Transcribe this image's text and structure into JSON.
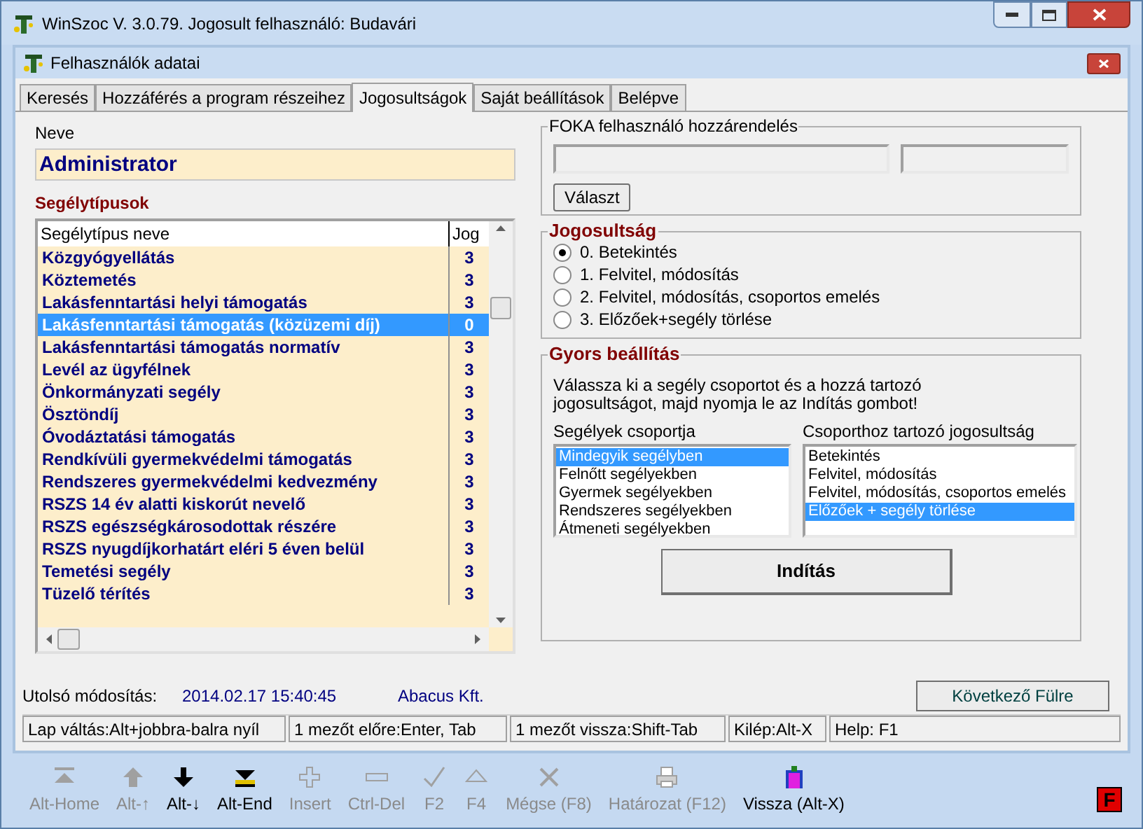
{
  "window": {
    "title": "WinSzoc V. 3.0.79. Jogosult felhasználó: Budavári"
  },
  "dialog": {
    "title": "Felhasználók adatai"
  },
  "tabs": [
    {
      "label": "Keresés",
      "selected": false
    },
    {
      "label": "Hozzáférés a program részeihez",
      "selected": false
    },
    {
      "label": "Jogosultságok",
      "selected": true
    },
    {
      "label": "Saját beállítások",
      "selected": false
    },
    {
      "label": "Belépve",
      "selected": false
    }
  ],
  "name_field": {
    "label": "Neve",
    "value": "Administrator"
  },
  "types": {
    "heading": "Segélytípusok",
    "columns": [
      "Segélytípus neve",
      "Jog"
    ],
    "rows": [
      {
        "name": "Közgyógyellátás",
        "jog": "3",
        "selected": false
      },
      {
        "name": "Köztemetés",
        "jog": "3",
        "selected": false
      },
      {
        "name": "Lakásfenntartási helyi támogatás",
        "jog": "3",
        "selected": false
      },
      {
        "name": "Lakásfenntartási támogatás (közüzemi díj)",
        "jog": "0",
        "selected": true
      },
      {
        "name": "Lakásfenntartási támogatás normatív",
        "jog": "3",
        "selected": false
      },
      {
        "name": "Levél az ügyfélnek",
        "jog": "3",
        "selected": false
      },
      {
        "name": "Önkormányzati segély",
        "jog": "3",
        "selected": false
      },
      {
        "name": "Ösztöndíj",
        "jog": "3",
        "selected": false
      },
      {
        "name": "Óvodáztatási támogatás",
        "jog": "3",
        "selected": false
      },
      {
        "name": "Rendkívüli gyermekvédelmi támogatás",
        "jog": "3",
        "selected": false
      },
      {
        "name": "Rendszeres gyermekvédelmi kedvezmény",
        "jog": "3",
        "selected": false
      },
      {
        "name": "RSZS 14 év alatti kiskorút nevelő",
        "jog": "3",
        "selected": false
      },
      {
        "name": "RSZS egészségkárosodottak részére",
        "jog": "3",
        "selected": false
      },
      {
        "name": "RSZS nyugdíjkorhatárt eléri 5 éven belül",
        "jog": "3",
        "selected": false
      },
      {
        "name": "Temetési segély",
        "jog": "3",
        "selected": false
      },
      {
        "name": "Tüzelő térítés",
        "jog": "3",
        "selected": false
      }
    ]
  },
  "foka": {
    "title": "FOKA felhasználó hozzárendelés",
    "button": "Választ"
  },
  "jogosultsag": {
    "title": "Jogosultság",
    "options": [
      {
        "label": "0. Betekintés",
        "selected": true
      },
      {
        "label": "1. Felvitel, módosítás",
        "selected": false
      },
      {
        "label": "2. Felvitel, módosítás, csoportos emelés",
        "selected": false
      },
      {
        "label": "3. Előzőek+segély törlése",
        "selected": false
      }
    ]
  },
  "gyors": {
    "title": "Gyors beállítás",
    "instructions": "Válassza ki a segély csoportot és a  hozzá tartozó jogosultságot, majd nyomja le az Indítás gombot!",
    "groups_label": "Segélyek csoportja",
    "groups": [
      {
        "label": "Mindegyik segélyben",
        "selected": true
      },
      {
        "label": "Felnőtt segélyekben",
        "selected": false
      },
      {
        "label": "Gyermek segélyekben",
        "selected": false
      },
      {
        "label": "Rendszeres segélyekben",
        "selected": false
      },
      {
        "label": "Átmeneti segélyekben",
        "selected": false
      }
    ],
    "rights_label": "Csoporthoz tartozó jogosultság",
    "rights": [
      {
        "label": "Betekintés",
        "selected": false
      },
      {
        "label": "Felvitel, módosítás",
        "selected": false
      },
      {
        "label": "Felvitel, módosítás, csoportos emelés",
        "selected": false
      },
      {
        "label": "Előzőek + segély törlése",
        "selected": true
      }
    ],
    "start_button": "Indítás"
  },
  "last_modified": {
    "label": "Utolsó módosítás:",
    "timestamp": "2014.02.17 15:40:45",
    "company": "Abacus Kft."
  },
  "next_tab_button": "Következő Fülre",
  "status_bar": [
    "Lap váltás:Alt+jobbra-balra nyíl",
    "1 mezőt előre:Enter, Tab",
    "1 mezőt vissza:Shift-Tab",
    "Kilép:Alt-X",
    "Help: F1"
  ],
  "toolbar": [
    {
      "label": "Alt-Home",
      "disabled": true
    },
    {
      "label": "Alt-↑",
      "disabled": true
    },
    {
      "label": "Alt-↓",
      "disabled": false
    },
    {
      "label": "Alt-End",
      "disabled": false
    },
    {
      "label": "Insert",
      "disabled": true
    },
    {
      "label": "Ctrl-Del",
      "disabled": true
    },
    {
      "label": "F2",
      "disabled": true
    },
    {
      "label": "F4",
      "disabled": true
    },
    {
      "label": "Mégse (F8)",
      "disabled": true
    },
    {
      "label": "Határozat (F12)",
      "disabled": true
    },
    {
      "label": "Vissza (Alt-X)",
      "disabled": false
    }
  ],
  "corner_badge": "F"
}
